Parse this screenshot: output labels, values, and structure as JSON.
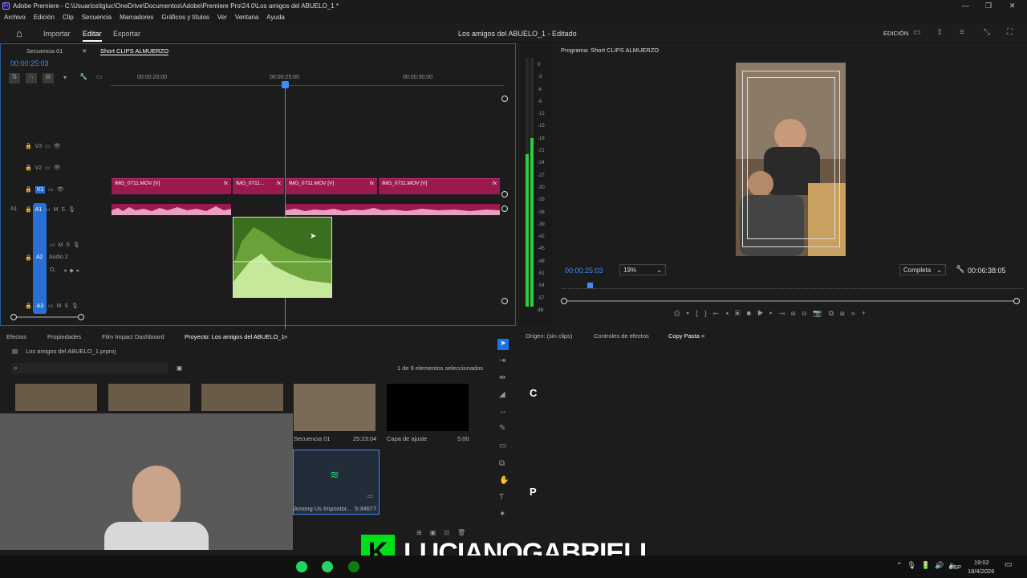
{
  "window": {
    "title": "Adobe Premiere - C:\\Usuarios\\tgluc\\OneDrive\\Documentos\\Adobe\\Premiere Pro\\24.0\\Los amigos del ABUELO_1 *"
  },
  "menu": [
    "Archivo",
    "Edición",
    "Clip",
    "Secuencia",
    "Marcadores",
    "Gráficos y títulos",
    "Ver",
    "Ventana",
    "Ayuda"
  ],
  "header": {
    "import": "Importar",
    "edit": "Editar",
    "export": "Exportar",
    "project_title": "Los amigos del ABUELO_1 - Editado",
    "workspace": "EDICIÓN"
  },
  "timeline": {
    "tab1": "Secuencia 01",
    "tab2": "Short CLIPS ALMUERZO",
    "timecode": "00:00:25:03",
    "ruler": [
      "00:00:20:00",
      "00:00:25:00",
      "00:00:30:00"
    ],
    "tracks": {
      "v3": "V3",
      "v2": "V2",
      "v1": "V1",
      "a1": "A1",
      "a2": "A2",
      "a2_name": "Audio 2",
      "a3": "A3",
      "a1_src": "A1",
      "m": "M",
      "s": "S",
      "o": "O,"
    },
    "clips": [
      "IMG_0711.MOV [V]",
      "IMG_0711...",
      "IMG_0711.MOV [V]",
      "IMG_0711.MOV [V]"
    ],
    "fx": "fx"
  },
  "meter": {
    "labels": [
      "0",
      "-3",
      "-6",
      "-9",
      "-12",
      "-15",
      "-18",
      "-21",
      "-24",
      "-27",
      "-30",
      "-33",
      "-36",
      "-39",
      "-42",
      "-45",
      "-48",
      "-51",
      "-54",
      "-57",
      "dB"
    ]
  },
  "program": {
    "title": "Programa: Short CLIPS ALMUERZO",
    "timecode": "00:00:25:03",
    "zoom": "19%",
    "quality": "Completa",
    "duration": "00:06:38:05"
  },
  "project": {
    "tabs": [
      "Efectos",
      "Propiedades",
      "Film Impact Dashboard",
      "Proyecto: Los amigos del ABUELO_1"
    ],
    "file": "Los amigos del ABUELO_1.prproj",
    "selected": "1 de 9 elementos seleccionados",
    "items": [
      {
        "name": "Secuencia 01",
        "dur": "25:23:04"
      },
      {
        "name": "Capa de ajuste",
        "dur": "5:00"
      },
      {
        "name": "Among Us Impostor...",
        "dur": "5:34677"
      }
    ]
  },
  "source": {
    "tabs": [
      "Origen: (sin clips)",
      "Controles de efectos",
      "Copy Pasta"
    ],
    "letter_c": "C",
    "letter_p": "P"
  },
  "overlay": {
    "name": "LUCIANOGABRIELI"
  },
  "taskbar": {
    "lang": "ESP",
    "time": "19:02",
    "date": "18/4/2026"
  },
  "colors": {
    "clip": "#9b1850",
    "accent": "#2a6fd6",
    "meter": "#2ecc40",
    "overlay_green": "#00e01a"
  }
}
